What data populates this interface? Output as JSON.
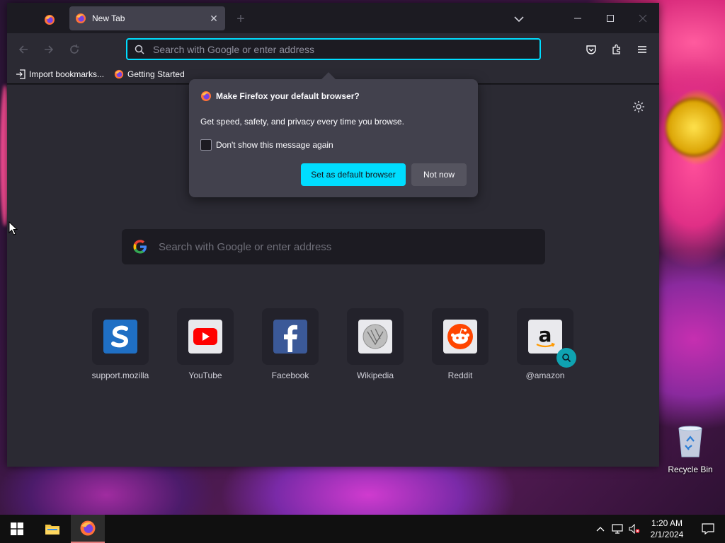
{
  "browser": {
    "tabs": [
      {
        "title": "New Tab",
        "close": "✕"
      }
    ],
    "new_tab_symbol": "+",
    "window_controls": {
      "minimize": "—",
      "maximize": "☐",
      "close": "✕"
    },
    "url_placeholder": "Search with Google or enter address",
    "bookmarks": [
      {
        "label": "Import bookmarks...",
        "icon": "import-icon"
      },
      {
        "label": "Getting Started",
        "icon": "firefox-icon"
      }
    ]
  },
  "newtab": {
    "search_placeholder": "Search with Google or enter address",
    "tiles": [
      {
        "label": "support.mozilla",
        "icon": "mozilla-support-icon"
      },
      {
        "label": "YouTube",
        "icon": "youtube-icon"
      },
      {
        "label": "Facebook",
        "icon": "facebook-icon"
      },
      {
        "label": "Wikipedia",
        "icon": "wikipedia-icon"
      },
      {
        "label": "Reddit",
        "icon": "reddit-icon"
      },
      {
        "label": "@amazon",
        "icon": "amazon-icon"
      }
    ]
  },
  "popup": {
    "title": "Make Firefox your default browser?",
    "description": "Get speed, safety, and privacy every time you browse.",
    "checkbox_label": "Don't show this message again",
    "checkbox_checked": false,
    "primary_button": "Set as default browser",
    "secondary_button": "Not now"
  },
  "desktop": {
    "recycle_bin_label": "Recycle Bin"
  },
  "taskbar": {
    "time": "1:20 AM",
    "date": "2/1/2024"
  },
  "colors": {
    "accent": "#00ddff",
    "toolbar": "#2b2a33",
    "tabbar": "#1c1b22",
    "popup": "#42414d"
  }
}
